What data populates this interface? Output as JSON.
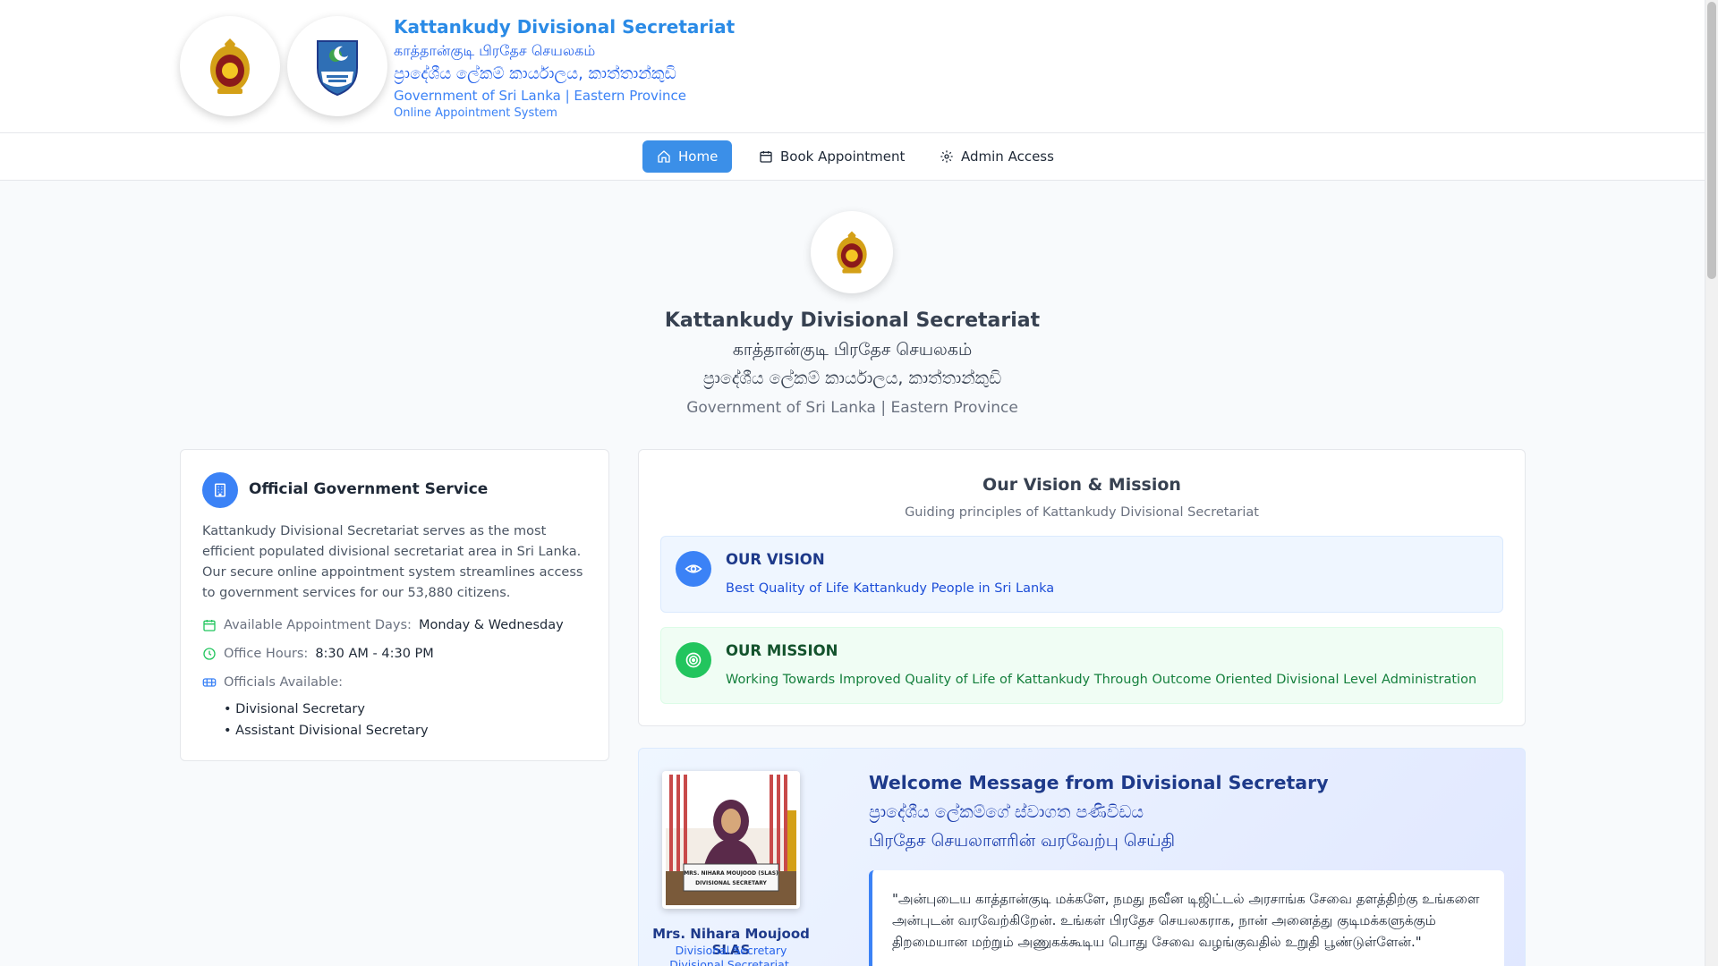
{
  "header": {
    "title": "Kattankudy Divisional Secretariat",
    "tamil": "காத்தான்குடி பிரதேச செயலகம்",
    "sinhala": "ප්‍රාදේශීය ලේකම් කාර්යාලය, කාත්තාන්කුඩි",
    "government": "Government of Sri Lanka | Eastern Province",
    "system": "Online Appointment System"
  },
  "nav": {
    "home": "Home",
    "book": "Book Appointment",
    "admin": "Admin Access"
  },
  "hero": {
    "title": "Kattankudy Divisional Secretariat",
    "tamil": "காத்தான்குடி பிரதேச செயலகம்",
    "sinhala": "ප්‍රාදේශීය ලේකම් කාර්යාලය, කාත්තාන්කුඩි",
    "government": "Government of Sri Lanka | Eastern Province"
  },
  "service": {
    "title": "Official Government Service",
    "description": "Kattankudy Divisional Secretariat serves as the most efficient populated divisional secretariat area in Sri Lanka. Our secure online appointment system streamlines access to government services for our 53,880 citizens.",
    "days_label": "Available Appointment Days:",
    "days_value": "Monday & Wednesday",
    "hours_label": "Office Hours:",
    "hours_value": "8:30 AM - 4:30 PM",
    "officials_label": "Officials Available:",
    "officials": [
      "• Divisional Secretary",
      "• Assistant Divisional Secretary"
    ]
  },
  "vision_mission": {
    "title": "Our Vision & Mission",
    "subtitle": "Guiding principles of Kattankudy Divisional Secretariat",
    "vision_heading": "OUR VISION",
    "vision_text": "Best Quality of Life Kattankudy People in Sri Lanka",
    "mission_heading": "OUR MISSION",
    "mission_text": "Working Towards Improved Quality of Life of Kattankudy Through Outcome Oriented Divisional Level Administration"
  },
  "welcome": {
    "title": "Welcome Message from Divisional Secretary",
    "sinhala": "ප්‍රාදේශීය ලේකම්ගේ ස්වාගත පණිවිඩය",
    "tamil": "பிரதேச செயலாளரின் வரவேற்பு செய்தி",
    "name": "Mrs. Nihara Moujood SLAS",
    "role": "Divisional Secretary",
    "office": "Divisional Secretariat, Kattankudy",
    "nameplate_line1": "MRS. NIHARA MOUJOOD (SLAS)",
    "nameplate_line2": "DIVISIONAL SECRETARY",
    "quote": "\"அன்புடைய காத்தான்குடி மக்களே, நமது நவீன டிஜிட்டல் அரசாங்க சேவை தளத்திற்கு உங்களை அன்புடன் வரவேற்கிறேன். உங்கள் பிரதேச செயலகராக, நான் அனைத்து குடிமக்களுக்கும் திறமையான மற்றும் அணுகக்கூடிய பொது சேவை வழங்குவதில் உறுதி பூண்டுள்ளேன்.\""
  },
  "colors": {
    "brand": "#2b8be6",
    "primary": "#3b82f6",
    "vision_bg": "#eff6ff",
    "mission_bg": "#f0fdf4",
    "mission_accent": "#22c55e"
  },
  "icons": {
    "nav_home": "home-icon",
    "nav_book": "calendar-icon",
    "nav_admin": "gear-icon",
    "service": "building-icon",
    "days": "calendar-icon",
    "hours": "clock-icon",
    "officials": "users-icon",
    "vision": "eye-icon",
    "mission": "target-icon"
  }
}
